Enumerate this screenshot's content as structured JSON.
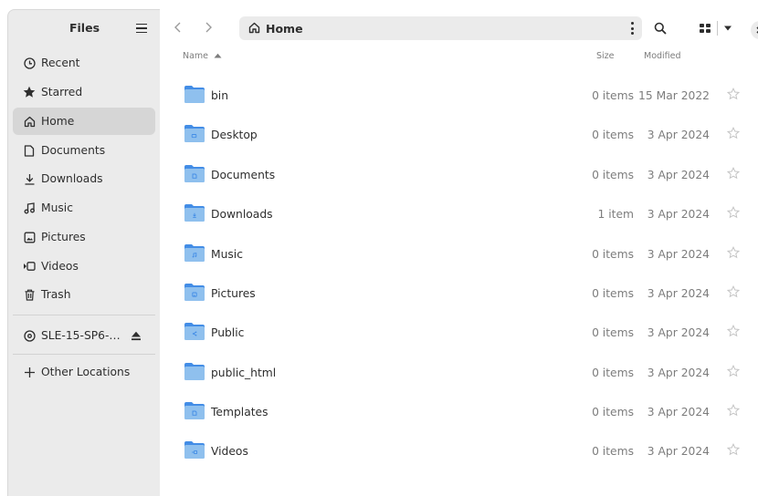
{
  "sidebar": {
    "title": "Files",
    "places": [
      {
        "label": "Recent",
        "icon": "clock-icon"
      },
      {
        "label": "Starred",
        "icon": "star-icon"
      },
      {
        "label": "Home",
        "icon": "home-icon",
        "active": true
      },
      {
        "label": "Documents",
        "icon": "document-icon"
      },
      {
        "label": "Downloads",
        "icon": "download-icon"
      },
      {
        "label": "Music",
        "icon": "music-icon"
      },
      {
        "label": "Pictures",
        "icon": "picture-icon"
      },
      {
        "label": "Videos",
        "icon": "video-icon"
      },
      {
        "label": "Trash",
        "icon": "trash-icon"
      }
    ],
    "devices": [
      {
        "label": "SLE-15-SP6-…",
        "icon": "disc-icon"
      }
    ],
    "other": {
      "label": "Other Locations",
      "icon": "plus-icon"
    }
  },
  "toolbar": {
    "path": "Home"
  },
  "columns": {
    "name": "Name",
    "size": "Size",
    "modified": "Modified"
  },
  "files": [
    {
      "name": "bin",
      "size": "0 items",
      "modified": "15 Mar 2022",
      "emblem": ""
    },
    {
      "name": "Desktop",
      "size": "0 items",
      "modified": "3 Apr 2024",
      "emblem": "desktop"
    },
    {
      "name": "Documents",
      "size": "0 items",
      "modified": "3 Apr 2024",
      "emblem": "document"
    },
    {
      "name": "Downloads",
      "size": "1 item",
      "modified": "3 Apr 2024",
      "emblem": "download"
    },
    {
      "name": "Music",
      "size": "0 items",
      "modified": "3 Apr 2024",
      "emblem": "music"
    },
    {
      "name": "Pictures",
      "size": "0 items",
      "modified": "3 Apr 2024",
      "emblem": "picture"
    },
    {
      "name": "Public",
      "size": "0 items",
      "modified": "3 Apr 2024",
      "emblem": "share"
    },
    {
      "name": "public_html",
      "size": "0 items",
      "modified": "3 Apr 2024",
      "emblem": ""
    },
    {
      "name": "Templates",
      "size": "0 items",
      "modified": "3 Apr 2024",
      "emblem": "template"
    },
    {
      "name": "Videos",
      "size": "0 items",
      "modified": "3 Apr 2024",
      "emblem": "video"
    }
  ],
  "colors": {
    "sidebar_bg": "#ebebeb",
    "active_item": "#d6d6d6",
    "folder_blue": "#8fc0ee",
    "folder_tab": "#438de6",
    "muted_text": "#7d7d7d"
  }
}
